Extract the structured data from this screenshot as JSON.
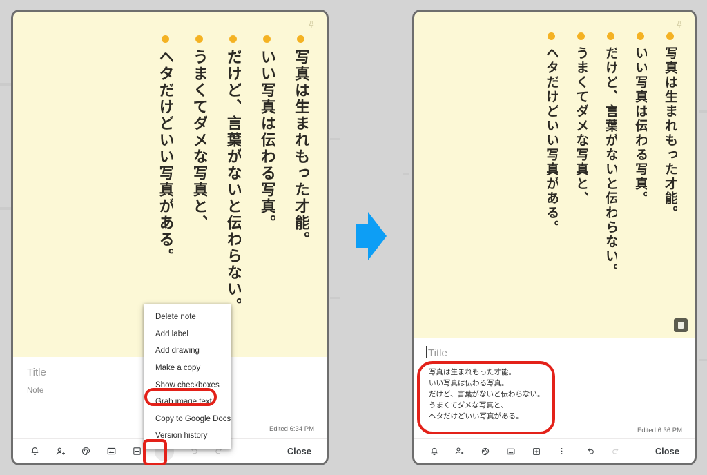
{
  "page": {
    "background_color": "#d4d4d4",
    "note_color": "#fcf8d6",
    "accent_red": "#e32119",
    "arrow_color": "#0d9ef5",
    "bullet_color": "#f4b223"
  },
  "arrow": {
    "icon": "right-arrow-icon"
  },
  "note_text_columns": [
    "写真は生まれもった才能。",
    "いい写真は伝わる写真。",
    "だけど、言葉がないと伝わらない。",
    "うまくてダメな写真と、",
    "ヘタだけどいい写真がある。"
  ],
  "left_panel": {
    "pin_icon": "pin-icon",
    "title_placeholder": "Title",
    "note_placeholder": "Note",
    "edited": "Edited 6:34 PM",
    "close_label": "Close",
    "toolbar_icons": [
      "reminder-bell-icon",
      "add-collaborator-icon",
      "color-palette-icon",
      "add-image-icon",
      "archive-icon",
      "more-options-icon",
      "undo-icon",
      "redo-icon"
    ],
    "menu": {
      "items": [
        "Delete note",
        "Add label",
        "Add drawing",
        "Make a copy",
        "Show checkboxes",
        "Grab image text",
        "Copy to Google Docs",
        "Version history"
      ],
      "highlighted_item": "Grab image text"
    }
  },
  "right_panel": {
    "pin_icon": "pin-icon",
    "image_badge_icon": "image-source-badge-icon",
    "title_placeholder": "Title",
    "edited": "Edited 6:36 PM",
    "close_label": "Close",
    "ocr_text": "写真は生まれもった才能。\nいい写真は伝わる写真。\nだけど、言葉がないと伝わらない。\nうまくてダメな写真と、\nヘタだけどいい写真がある。",
    "toolbar_icons": [
      "reminder-bell-icon",
      "add-collaborator-icon",
      "color-palette-icon",
      "add-image-icon",
      "archive-icon",
      "more-options-icon",
      "undo-icon",
      "redo-icon"
    ]
  }
}
